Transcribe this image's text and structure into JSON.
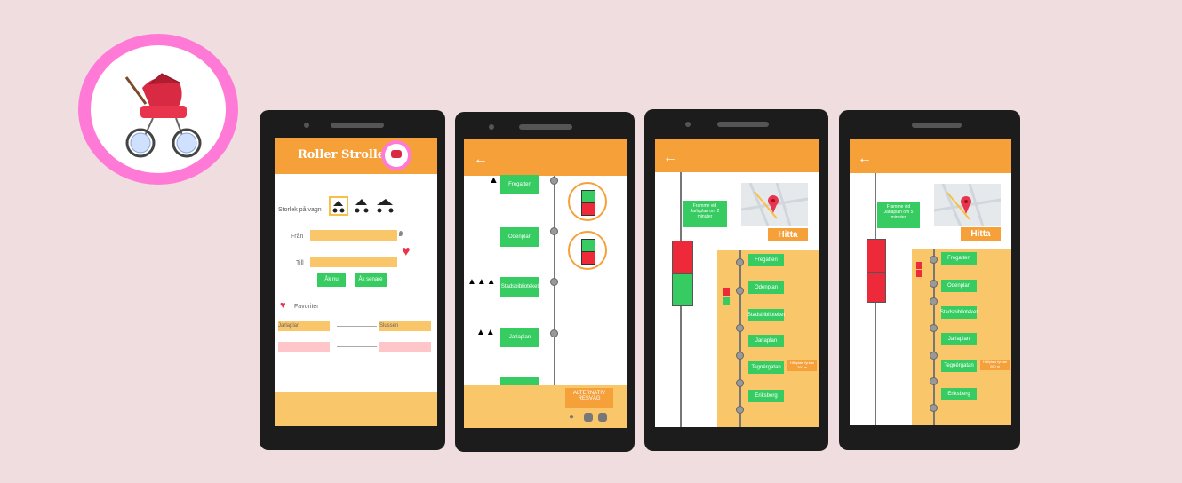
{
  "app_title": "Roller Stroller",
  "screen1": {
    "size_label": "Storlek på vagn",
    "from_label": "Från",
    "to_label": "Till",
    "go_now": "Åk nu",
    "go_later": "Åk senare",
    "favorites_label": "Favoriter",
    "fav_from": "Jarlaplan",
    "fav_to": "Slussen"
  },
  "screen2": {
    "stops": [
      "Fregatten",
      "Odenplan",
      "Stadsbiblioteket",
      "Jarlaplan"
    ],
    "alt_route": "ALTERNATIV RESVÄG"
  },
  "screen3": {
    "bubble": "Framme vid Jarlaplan om 2 minuter",
    "find": "Hitta",
    "stops": [
      "Fregatten",
      "Odenplan",
      "Stadsbiblioteket",
      "Jarlaplan",
      "Tegnérgatan",
      "Eriksberg"
    ],
    "warning": "Hållplats fyrkan 200 m"
  },
  "screen4": {
    "bubble": "Framme vid Jarlaplan om 5 minuter",
    "find": "Hitta",
    "stops": [
      "Fregatten",
      "Odenplan",
      "Stadsbiblioteket",
      "Jarlaplan",
      "Tegnérgatan",
      "Eriksberg"
    ],
    "warning": "Hållplats fyrkan 200 m"
  },
  "colors": {
    "orange": "#f6a03a",
    "green": "#36cc61",
    "yellow": "#f9c66a",
    "red": "#ee2a3a",
    "pink": "#ff7ad6"
  },
  "icons": [
    "stroller-logo",
    "back-arrow-icon",
    "heart-icon",
    "pin-icon",
    "map-marker-icon",
    "walk-icon",
    "train-icon",
    "bus-icon"
  ]
}
